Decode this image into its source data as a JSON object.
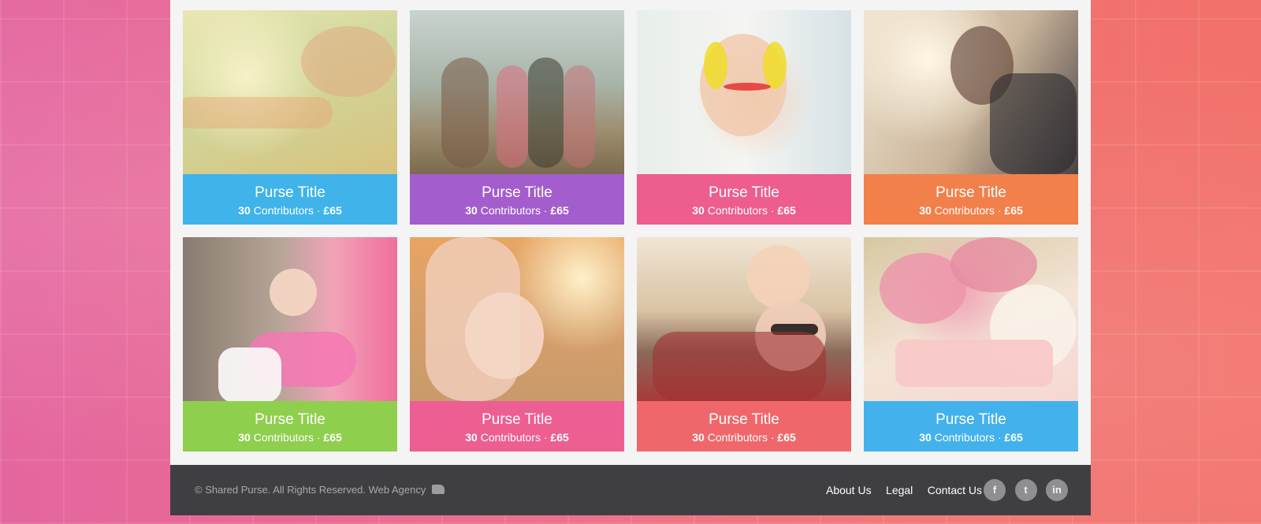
{
  "cards": [
    {
      "title": "Purse Title",
      "count": "30",
      "meta": " Contributors · ",
      "amount": "£65",
      "color": "#3fb3ea"
    },
    {
      "title": "Purse Title",
      "count": "30",
      "meta": " Contributors · ",
      "amount": "£65",
      "color": "#a45dcd"
    },
    {
      "title": "Purse Title",
      "count": "30",
      "meta": " Contributors · ",
      "amount": "£65",
      "color": "#ed5d8e"
    },
    {
      "title": "Purse Title",
      "count": "30",
      "meta": " Contributors · ",
      "amount": "£65",
      "color": "#f2804b"
    },
    {
      "title": "Purse Title",
      "count": "30",
      "meta": " Contributors · ",
      "amount": "£65",
      "color": "#8fcf4e"
    },
    {
      "title": "Purse Title",
      "count": "30",
      "meta": " Contributors · ",
      "amount": "£65",
      "color": "#ed5e92"
    },
    {
      "title": "Purse Title",
      "count": "30",
      "meta": " Contributors · ",
      "amount": "£65",
      "color": "#f0676b"
    },
    {
      "title": "Purse Title",
      "count": "30",
      "meta": " Contributors · ",
      "amount": "£65",
      "color": "#43b2ec"
    }
  ],
  "footer": {
    "copyright": "© Shared Purse. All Rights Reserved. Web Agency",
    "links": [
      "About Us",
      "Legal",
      "Contact Us"
    ],
    "social": [
      {
        "icon": "facebook-icon",
        "glyph": "f"
      },
      {
        "icon": "twitter-icon",
        "glyph": "t"
      },
      {
        "icon": "linkedin-icon",
        "glyph": "in"
      }
    ]
  }
}
